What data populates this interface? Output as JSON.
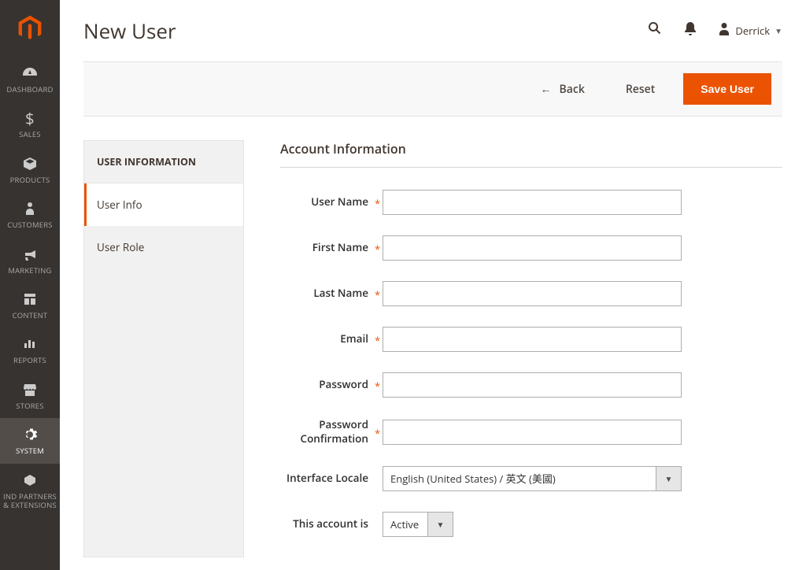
{
  "sidebar": {
    "items": [
      {
        "label": "DASHBOARD"
      },
      {
        "label": "SALES"
      },
      {
        "label": "PRODUCTS"
      },
      {
        "label": "CUSTOMERS"
      },
      {
        "label": "MARKETING"
      },
      {
        "label": "CONTENT"
      },
      {
        "label": "REPORTS"
      },
      {
        "label": "STORES"
      },
      {
        "label": "SYSTEM"
      },
      {
        "label": "IND PARTNERS & EXTENSIONS"
      }
    ]
  },
  "header": {
    "title": "New User",
    "username": "Derrick"
  },
  "toolbar": {
    "back_label": "Back",
    "reset_label": "Reset",
    "save_label": "Save User"
  },
  "side_tabs": {
    "title": "USER INFORMATION",
    "items": [
      {
        "label": "User Info"
      },
      {
        "label": "User Role"
      }
    ]
  },
  "form": {
    "fieldset_title": "Account Information",
    "fields": {
      "username": {
        "label": "User Name",
        "value": ""
      },
      "firstname": {
        "label": "First Name",
        "value": ""
      },
      "lastname": {
        "label": "Last Name",
        "value": ""
      },
      "email": {
        "label": "Email",
        "value": ""
      },
      "password": {
        "label": "Password",
        "value": ""
      },
      "password_confirm": {
        "label": "Password Confirmation",
        "value": ""
      },
      "locale": {
        "label": "Interface Locale",
        "value": "English (United States) / 英文 (美國)"
      },
      "account_status": {
        "label": "This account is",
        "value": "Active"
      }
    }
  }
}
